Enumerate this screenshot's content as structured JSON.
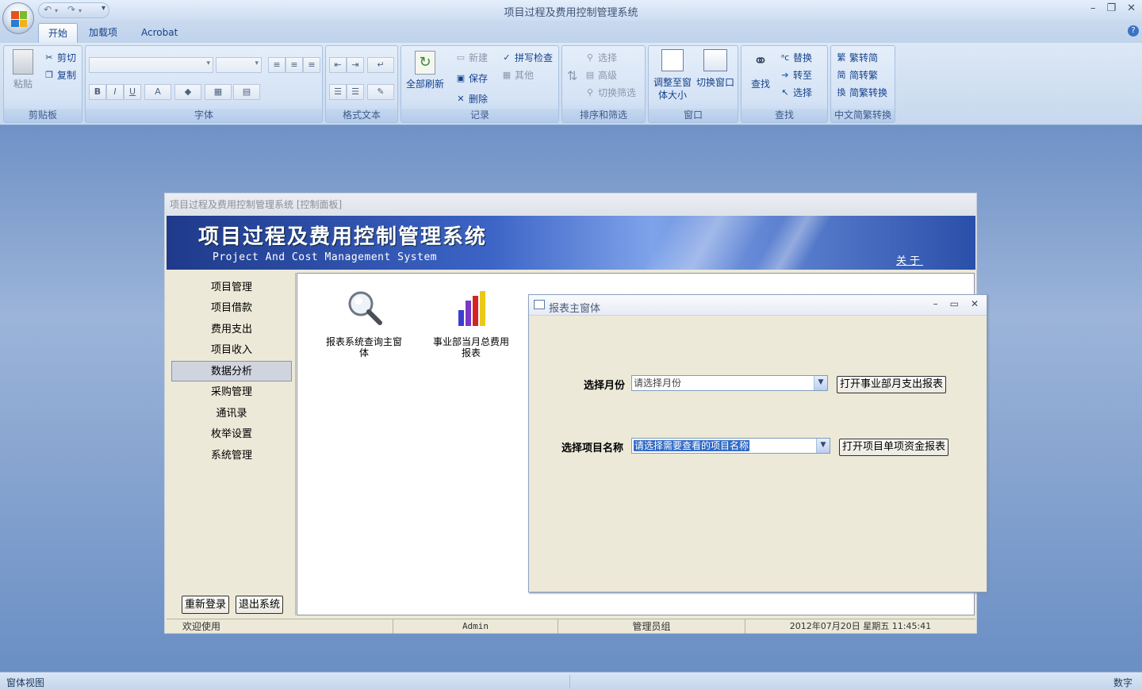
{
  "app": {
    "title": "项目过程及费用控制管理系统"
  },
  "tabs": [
    {
      "label": "开始"
    },
    {
      "label": "加载项"
    },
    {
      "label": "Acrobat"
    }
  ],
  "ribbon": {
    "clipboard": {
      "label": "剪贴板",
      "paste": "粘贴",
      "cut": "剪切",
      "copy": "复制"
    },
    "font": {
      "label": "字体",
      "bold": "B",
      "italic": "I",
      "underline": "U",
      "color_a": "A"
    },
    "rich_text": {
      "label": "格式文本"
    },
    "records": {
      "label": "记录",
      "refresh_all": "全部刷新",
      "new": "新建",
      "save": "保存",
      "delete": "删除",
      "spelling": "拼写检查",
      "more": "其他"
    },
    "sort_filter": {
      "label": "排序和筛选",
      "selection": "选择",
      "advanced": "高级",
      "toggle_filter": "切换筛选"
    },
    "window": {
      "label": "窗口",
      "size_to_fit": "调整至窗体大小",
      "switch_windows": "切换窗口"
    },
    "find": {
      "label": "查找",
      "find": "查找",
      "replace": "替换",
      "goto": "转至",
      "select": "选择"
    },
    "chinese": {
      "label": "中文简繁转换",
      "t2s": "繁转简",
      "s2t": "简转繁",
      "convert": "简繁转换"
    }
  },
  "form": {
    "title": "项目过程及费用控制管理系统 [控制面板]",
    "banner_title": "项目过程及费用控制管理系统",
    "banner_subtitle": "Project And Cost Management System",
    "about_link": "关于"
  },
  "nav": {
    "items": [
      {
        "label": "项目管理"
      },
      {
        "label": "项目借款"
      },
      {
        "label": "费用支出"
      },
      {
        "label": "项目收入"
      },
      {
        "label": "数据分析"
      },
      {
        "label": "采购管理"
      },
      {
        "label": "通讯录"
      },
      {
        "label": "枚举设置"
      },
      {
        "label": "系统管理"
      }
    ],
    "active_index": 4,
    "relogin": "重新登录",
    "exit": "退出系统"
  },
  "content": {
    "icons": [
      {
        "label": "报表系统查询主窗体",
        "icon": "magnifier-icon"
      },
      {
        "label": "事业部当月总费用报表",
        "icon": "bar-chart-icon"
      }
    ]
  },
  "status": {
    "welcome": "欢迎使用",
    "user": "Admin",
    "group": "管理员组",
    "datetime": "2012年07月20日 星期五 11:45:41"
  },
  "popup": {
    "title": "报表主窗体",
    "month_label": "选择月份",
    "month_value": "请选择月份",
    "month_button": "打开事业部月支出报表",
    "project_label": "选择项目名称",
    "project_value": "请选择需要查看的项目名称",
    "project_button": "打开项目单项资金报表"
  },
  "app_status": {
    "left": "窗体视图",
    "right": "数字"
  }
}
